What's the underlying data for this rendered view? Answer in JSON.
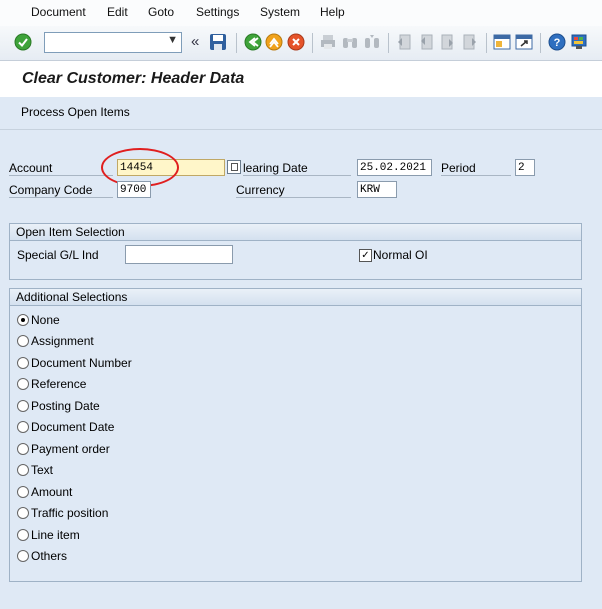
{
  "menu": [
    "Document",
    "Edit",
    "Goto",
    "Settings",
    "System",
    "Help"
  ],
  "menu_mnemonics": [
    "D",
    "E",
    "G",
    "S",
    "y",
    "H"
  ],
  "toolbar": {
    "command_field_value": "",
    "icons": [
      "enter-icon",
      "back-icon",
      "exit-icon",
      "cancel-icon",
      "print-icon",
      "find-icon",
      "find-next-icon",
      "first-page-icon",
      "previous-page-icon",
      "next-page-icon",
      "last-page-icon",
      "create-session-icon",
      "shortcut-icon",
      "help-icon",
      "customize-layout-icon"
    ]
  },
  "title": "Clear Customer: Header Data",
  "app_toolbar": {
    "process_open_items": "Process Open Items"
  },
  "header": {
    "account_label": "Account",
    "account_value": "14454",
    "clearing_date_label": "Clearing Date",
    "clearing_date_visible": "learing Date",
    "clearing_date_value": "25.02.2021",
    "period_label": "Period",
    "period_value": "2",
    "company_code_label": "Company Code",
    "company_code_value": "9700",
    "currency_label": "Currency",
    "currency_value": "KRW"
  },
  "open_item_selection": {
    "title": "Open Item Selection",
    "special_gl_label": "Special G/L Ind",
    "special_gl_value": "",
    "normal_oi_label": "Normal OI",
    "normal_oi_checked": true
  },
  "additional_selections": {
    "title": "Additional Selections",
    "options": [
      "None",
      "Assignment",
      "Document Number",
      "Reference",
      "Posting Date",
      "Document Date",
      "Payment order",
      "Text",
      "Amount",
      "Traffic position",
      "Line item",
      "Others"
    ],
    "selected": "None"
  },
  "colors": {
    "highlight_circle": "#e01f1f",
    "required_field": "#fff6c9",
    "background": "#dfe9f5"
  }
}
